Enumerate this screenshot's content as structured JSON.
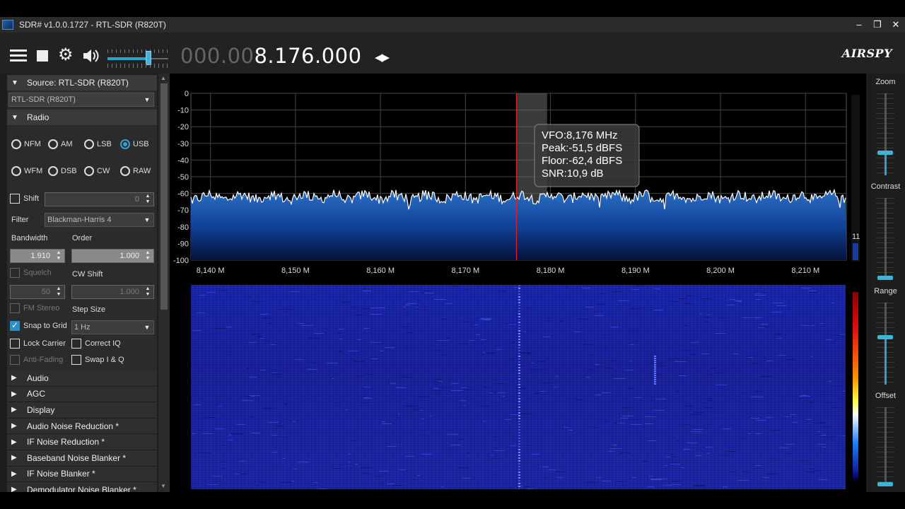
{
  "window": {
    "title": "SDR# v1.0.0.1727 - RTL-SDR (R820T)"
  },
  "toolbar": {
    "freq_dim": "000.00",
    "freq_bright": "8.176.000",
    "brand": "AIRSPY",
    "volume_level": 0.68
  },
  "source": {
    "header": "Source: RTL-SDR (R820T)",
    "device": "RTL-SDR (R820T)"
  },
  "radio": {
    "header": "Radio",
    "modes": [
      "NFM",
      "AM",
      "LSB",
      "USB",
      "WFM",
      "DSB",
      "CW",
      "RAW"
    ],
    "selected_mode": "USB",
    "shift_label": "Shift",
    "shift_value": "0",
    "filter_label": "Filter",
    "filter_value": "Blackman-Harris 4",
    "bandwidth_label": "Bandwidth",
    "bandwidth_value": "1.910",
    "order_label": "Order",
    "order_value": "1.000",
    "squelch_label": "Squelch",
    "squelch_value": "50",
    "cwshift_label": "CW Shift",
    "cwshift_value": "1.000",
    "fmstereo_label": "FM Stereo",
    "stepsize_label": "Step Size",
    "snap_label": "Snap to Grid",
    "step_value": "1 Hz",
    "lockcarrier_label": "Lock Carrier",
    "correctiq_label": "Correct IQ",
    "antifading_label": "Anti-Fading",
    "swapiq_label": "Swap I & Q"
  },
  "collapsed_sections": [
    "Audio",
    "AGC",
    "Display",
    "Audio Noise Reduction *",
    "IF Noise Reduction *",
    "Baseband Noise Blanker *",
    "IF Noise Blanker *",
    "Demodulator Noise Blanker *"
  ],
  "spectrum": {
    "y_ticks": [
      "0",
      "-10",
      "-20",
      "-30",
      "-40",
      "-50",
      "-60",
      "-70",
      "-80",
      "-90",
      "-100"
    ],
    "x_ticks": [
      "8,140 M",
      "8,150 M",
      "8,160 M",
      "8,170 M",
      "8,180 M",
      "8,190 M",
      "8,200 M",
      "8,210 M"
    ],
    "x_range_mhz": [
      8.1377,
      8.2148
    ],
    "y_range_db": [
      -100,
      0
    ],
    "vfo_mhz": 8.176,
    "noise_floor_db": -62,
    "info": {
      "vfo": "VFO:8,176 MHz",
      "peak": "Peak:-51,5 dBFS",
      "floor": "Floor:-62,4 dBFS",
      "snr": "SNR:10,9 dB"
    },
    "side_value": "11",
    "trace_color": "#1c5bb0"
  },
  "rightpanel": {
    "zoom_label": "Zoom",
    "zoom_level": 0.3,
    "contrast_label": "Contrast",
    "contrast_level": 0.0,
    "range_label": "Range",
    "range_level": 0.6,
    "offset_label": "Offset",
    "offset_level": 0.0
  }
}
